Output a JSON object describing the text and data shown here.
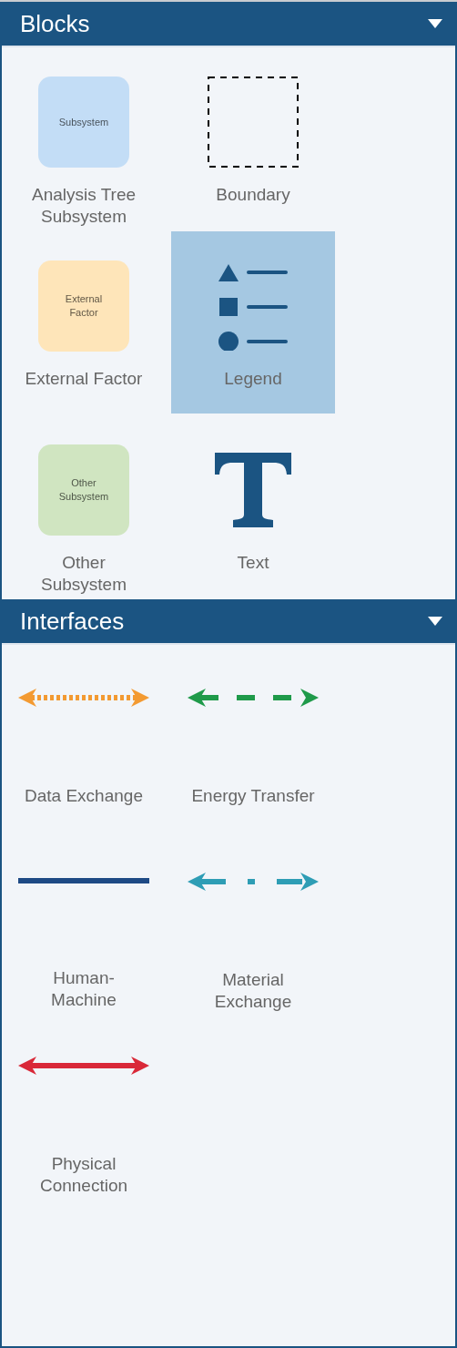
{
  "panels": [
    {
      "title": "Blocks",
      "expanded": true,
      "kind": "blocks",
      "items": [
        {
          "label": "Analysis Tree\nSubsystem",
          "kind": "box",
          "icon_label": "Subsystem",
          "color": "#c3ddf6",
          "selected": false
        },
        {
          "label": "Boundary",
          "kind": "boundary",
          "selected": false
        },
        {
          "label": "External Factor",
          "kind": "box",
          "icon_label": "External\nFactor",
          "color": "#fee5b9",
          "selected": false
        },
        {
          "label": "Legend",
          "kind": "legend",
          "selected": true
        },
        {
          "label": "Other\nSubsystem",
          "kind": "box",
          "icon_label": "Other\nSubsystem",
          "color": "#d0e5c1",
          "selected": false
        },
        {
          "label": "Text",
          "kind": "text",
          "selected": false
        }
      ]
    },
    {
      "title": "Interfaces",
      "expanded": true,
      "kind": "interfaces",
      "items": [
        {
          "label": "Data Exchange",
          "kind": "dotted",
          "color": "#f39a32",
          "heads": true,
          "selected": false
        },
        {
          "label": "Energy Transfer",
          "kind": "dashed",
          "color": "#1f9a4a",
          "heads": true,
          "selected": false
        },
        {
          "label": "Human-\nMachine",
          "kind": "solid",
          "color": "#1e4a85",
          "heads": false,
          "selected": false
        },
        {
          "label": "Material\nExchange",
          "kind": "dashdot",
          "color": "#2e9db5",
          "heads": true,
          "selected": false
        },
        {
          "label": "Physical\nConnection",
          "kind": "solid",
          "color": "#d92838",
          "heads": true,
          "selected": false
        }
      ]
    }
  ]
}
